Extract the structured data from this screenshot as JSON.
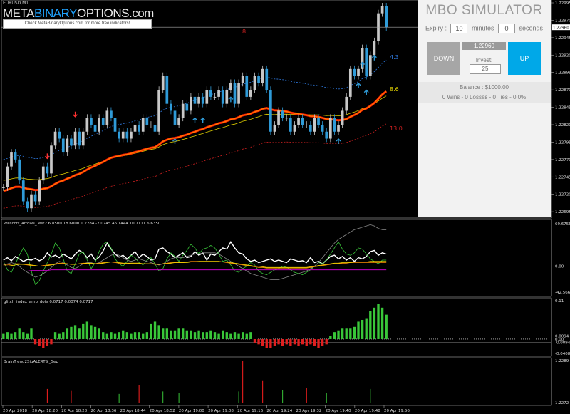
{
  "symbol_label": "EURUSD,M1",
  "watermark": {
    "part1": "META",
    "part2": "BINARY",
    "part3": "OPTIONS.com",
    "link_text": "Check MetaBinaryOptions.com for more free indicators!"
  },
  "mbo": {
    "title": "MBO SIMULATOR",
    "expiry_label": "Expiry :",
    "expiry_minutes": "10",
    "minutes_label": "minutes",
    "expiry_seconds": "0",
    "seconds_label": "seconds",
    "down_label": "DOWN",
    "up_label": "UP",
    "price": "1.22960",
    "invest_label": "Invest:",
    "invest_value": "25",
    "balance": "Balance : $1000.00",
    "stats": "0 Wins - 0 Losses - 0 Ties - 0.0%"
  },
  "colors": {
    "bull": "#c8c8c8",
    "bear": "#2f9bd8",
    "up_arrow": "#2f9bd8",
    "down_arrow": "#ff3030",
    "upper_band": "#2f7ae0",
    "lower_band": "#d02020",
    "ema_yellow": "#e0d000",
    "ema_orange": "#ff8000",
    "ema_red": "#ff2000"
  },
  "chart_data": [
    {
      "type": "candlestick",
      "title": "EURUSD,M1",
      "ylim": [
        1.2269,
        1.22995
      ],
      "yticks": [
        "1.22995",
        "1.22970",
        "1.22945",
        "1.22920",
        "1.22895",
        "1.22870",
        "1.22845",
        "1.22820",
        "1.22795",
        "1.22770",
        "1.22745",
        "1.22720",
        "1.22695"
      ],
      "current_price": "1.22960",
      "line_labels": [
        {
          "text": "4.3",
          "value": 1.22917,
          "color": "#2f7ae0"
        },
        {
          "text": "8.6",
          "value": 1.22871,
          "color": "#e0d000"
        },
        {
          "text": "13.0",
          "value": 1.22815,
          "color": "#d02020"
        },
        {
          "text": "8",
          "value": 1.22954,
          "color": "#d02020"
        }
      ],
      "closes": [
        1.2273,
        1.2276,
        1.2278,
        1.2277,
        1.2274,
        1.2271,
        1.227,
        1.2272,
        1.2271,
        1.2274,
        1.2276,
        1.2275,
        1.2279,
        1.2281,
        1.228,
        1.2278,
        1.228,
        1.2279,
        1.2281,
        1.2279,
        1.2281,
        1.2283,
        1.2282,
        1.2281,
        1.2283,
        1.2282,
        1.2284,
        1.2283,
        1.2281,
        1.228,
        1.2281,
        1.228,
        1.2281,
        1.2282,
        1.2281,
        1.2283,
        1.2282,
        1.2282,
        1.2281,
        1.2287,
        1.2289,
        1.2285,
        1.2284,
        1.2282,
        1.2283,
        1.2285,
        1.2284,
        1.2286,
        1.2285,
        1.2286,
        1.2285,
        1.2287,
        1.2286,
        1.2286,
        1.2287,
        1.2285,
        1.2287,
        1.2288,
        1.2285,
        1.2288,
        1.2289,
        1.2286,
        1.2287,
        1.2289,
        1.2288,
        1.229,
        1.2287,
        1.2281,
        1.2282,
        1.2284,
        1.2283,
        1.2283,
        1.2281,
        1.2282,
        1.2283,
        1.2282,
        1.2282,
        1.2281,
        1.2283,
        1.2282,
        1.2281,
        1.228,
        1.2283,
        1.2281,
        1.2282,
        1.2284,
        1.2286,
        1.229,
        1.2289,
        1.229,
        1.2293,
        1.2289,
        1.2292,
        1.2294,
        1.2298,
        1.2299,
        1.2296
      ],
      "up_arrow_bars": [
        43,
        48,
        50,
        57,
        84,
        89,
        90,
        91,
        93
      ],
      "down_arrow_bars": [
        11,
        18
      ]
    },
    {
      "type": "line",
      "title": "Prescott_Arrows_Test2 6.8500 18.6000 1.2284 -2.0745 46.1444 10.7111 6.6350",
      "ylim": [
        -42.5666,
        69.6756
      ],
      "yticks": [
        "69.6756",
        "0.00",
        "-42.5666"
      ],
      "series": [
        {
          "color": "#ffffff",
          "values": [
            10,
            14,
            9,
            16,
            12,
            8,
            11,
            10,
            13,
            9,
            12,
            22,
            15,
            18,
            14,
            20,
            16,
            12,
            20,
            26,
            22,
            14,
            20,
            10,
            15,
            25,
            38,
            28,
            20,
            15,
            18,
            12,
            18,
            24,
            14,
            20,
            16,
            10,
            12,
            28,
            30,
            24,
            20,
            14,
            18,
            22,
            14,
            16,
            24,
            18,
            22,
            10,
            20,
            18,
            24,
            30,
            28,
            40,
            30,
            22,
            20,
            12,
            8,
            10,
            6,
            8,
            10,
            12,
            8,
            10,
            8,
            6,
            12,
            10,
            8,
            9,
            6,
            14,
            6,
            8,
            4,
            10,
            16,
            18,
            12,
            16,
            10,
            14,
            8,
            14,
            12,
            16,
            24,
            26,
            18,
            22,
            20
          ]
        },
        {
          "color": "#39c639",
          "values": [
            8,
            -6,
            -10,
            4,
            18,
            30,
            20,
            -8,
            -30,
            -24,
            -8,
            6,
            20,
            38,
            30,
            12,
            -8,
            -12,
            4,
            20,
            24,
            10,
            -4,
            6,
            24,
            36,
            40,
            30,
            12,
            4,
            0,
            8,
            18,
            14,
            6,
            2,
            10,
            14,
            4,
            -8,
            -4,
            12,
            22,
            16,
            8,
            18,
            26,
            36,
            30,
            20,
            28,
            30,
            34,
            30,
            20,
            8,
            10,
            2,
            -8,
            -10,
            -4,
            0,
            6,
            2,
            -8,
            -12,
            -14,
            -10,
            -6,
            -4,
            0,
            -2,
            -6,
            -10,
            -12,
            -14,
            -10,
            -6,
            0,
            6,
            4,
            10,
            20,
            30,
            40,
            28,
            20,
            18,
            22,
            30,
            28,
            20,
            12,
            8,
            4,
            10,
            10
          ]
        },
        {
          "color": "#8a8a8a",
          "values": [
            2,
            4,
            6,
            4,
            0,
            -6,
            -10,
            -14,
            -18,
            -16,
            -12,
            -8,
            -2,
            4,
            8,
            6,
            2,
            -2,
            -4,
            0,
            4,
            6,
            6,
            4,
            6,
            10,
            14,
            18,
            20,
            18,
            14,
            10,
            8,
            10,
            12,
            10,
            8,
            6,
            4,
            2,
            4,
            8,
            12,
            14,
            14,
            14,
            16,
            18,
            20,
            20,
            22,
            22,
            22,
            22,
            20,
            16,
            12,
            8,
            4,
            0,
            -4,
            -8,
            -12,
            -14,
            -16,
            -18,
            -20,
            -22,
            -22,
            -22,
            -20,
            -18,
            -16,
            -14,
            -12,
            -10,
            -8,
            -4,
            0,
            6,
            14,
            22,
            30,
            38,
            44,
            48,
            52,
            56,
            60,
            62,
            64,
            66,
            68,
            66,
            62,
            60,
            60
          ]
        },
        {
          "color": "#ff9000",
          "values": [
            2,
            2,
            3,
            4,
            4,
            3,
            2,
            1,
            0,
            0,
            1,
            2,
            3,
            4,
            5,
            5,
            4,
            3,
            3,
            4,
            5,
            5,
            4,
            4,
            5,
            6,
            7,
            7,
            6,
            5,
            4,
            4,
            5,
            5,
            5,
            4,
            4,
            4,
            3,
            3,
            4,
            5,
            6,
            6,
            6,
            6,
            7,
            8,
            8,
            8,
            8,
            8,
            8,
            8,
            8,
            7,
            6,
            5,
            4,
            3,
            2,
            1,
            0,
            -1,
            -2,
            -2,
            -3,
            -3,
            -3,
            -3,
            -3,
            -3,
            -3,
            -3,
            -3,
            -3,
            -3,
            -2,
            -1,
            0,
            1,
            2,
            3,
            4,
            4,
            5,
            5,
            6,
            6,
            6,
            6,
            6,
            6,
            6,
            6,
            6,
            6
          ]
        },
        {
          "color": "#ffe000",
          "values": [
            0,
            0,
            1,
            2,
            3,
            3,
            3,
            2,
            1,
            0,
            0,
            1,
            2,
            3,
            4,
            4,
            4,
            3,
            3,
            4,
            4,
            5,
            5,
            4,
            4,
            5,
            6,
            7,
            7,
            6,
            5,
            5,
            5,
            5,
            5,
            4,
            4,
            4,
            4,
            3,
            4,
            4,
            5,
            6,
            6,
            6,
            6,
            7,
            7,
            8,
            8,
            8,
            8,
            8,
            8,
            7,
            7,
            6,
            5,
            4,
            3,
            2,
            1,
            0,
            0,
            -1,
            -2,
            -2,
            -2,
            -2,
            -2,
            -2,
            -2,
            -2,
            -2,
            -2,
            -2,
            -1,
            0,
            1,
            2,
            3,
            4,
            5,
            5,
            6,
            6,
            6,
            7,
            7,
            7,
            7,
            8,
            8,
            8,
            8,
            8
          ]
        },
        {
          "color": "#e000e0",
          "values": [
            -8,
            -8,
            -8,
            -8,
            -8,
            -8,
            -8,
            -7,
            -7,
            -7,
            -7,
            -7,
            -6,
            -6,
            -6,
            -6,
            -6,
            -6,
            -6,
            -6,
            -6,
            -6,
            -6,
            -6,
            -6,
            -6,
            -6,
            -6,
            -6,
            -6,
            -6,
            -6,
            -6,
            -6,
            -6,
            -6,
            -6,
            -6,
            -6,
            -6,
            -6,
            -6,
            -6,
            -6,
            -6,
            -6,
            -6,
            -6,
            -6,
            -6,
            -6,
            -6,
            -6,
            -6,
            -6,
            -6,
            -6,
            -6,
            -6,
            -6,
            -6,
            -6,
            -6,
            -6,
            -6,
            -6,
            -6,
            -6,
            -6,
            -6,
            -6,
            -6,
            -6,
            -6,
            -6,
            -6,
            -6,
            -6,
            -6,
            -6,
            -6,
            -6,
            -6,
            -6,
            -6,
            -6,
            -6,
            -6,
            -6,
            -6,
            -6,
            -6,
            -6,
            -6,
            -6,
            -6,
            -6
          ]
        }
      ]
    },
    {
      "type": "bar",
      "title": "glitch_index_amp_dots 0.0717 0.0074 0.0717",
      "ylim": [
        -0.0408,
        0.11
      ],
      "yticks": [
        "0.11",
        "0.0094",
        "0.00",
        "-0.0094",
        "-0.0408"
      ],
      "values": [
        0.015,
        0.02,
        0.015,
        0.02,
        0.03,
        0.02,
        0.015,
        0.03,
        -0.015,
        -0.02,
        -0.025,
        -0.02,
        -0.015,
        0.02,
        0.015,
        0.02,
        0.03,
        0.035,
        0.04,
        0.03,
        0.045,
        0.05,
        0.04,
        0.035,
        0.03,
        0.02,
        0.015,
        0.02,
        0.015,
        0.02,
        0.025,
        0.02,
        0.015,
        0.02,
        0.02,
        0.015,
        0.02,
        0.045,
        0.05,
        0.04,
        0.03,
        0.03,
        0.025,
        0.025,
        0.03,
        0.03,
        0.025,
        0.025,
        0.02,
        0.025,
        0.02,
        0.02,
        0.025,
        0.02,
        0.015,
        0.025,
        0.02,
        0.015,
        0.02,
        0.015,
        0.02,
        0.015,
        0.02,
        -0.01,
        -0.015,
        -0.02,
        -0.025,
        -0.025,
        -0.02,
        -0.015,
        -0.02,
        -0.015,
        -0.02,
        -0.015,
        -0.02,
        -0.015,
        -0.02,
        -0.015,
        -0.02,
        -0.025,
        -0.02,
        -0.015,
        0.01,
        0.02,
        0.025,
        0.03,
        0.03,
        0.03,
        0.035,
        0.05,
        0.055,
        0.06,
        0.08,
        0.09,
        0.1,
        0.09,
        0.07
      ]
    },
    {
      "type": "bar",
      "title": "BrainTrend2SigALERTS _Sep",
      "ylim": [
        1.2272,
        1.2289
      ],
      "yticks": [
        "1.2289",
        "1.2272"
      ],
      "bars": [
        {
          "bar": 11,
          "value": 1.22775,
          "color": "#ff2020"
        },
        {
          "bar": 17,
          "value": 1.22767,
          "color": "#ff2020"
        },
        {
          "bar": 29,
          "value": 1.22755,
          "color": "#39c639"
        },
        {
          "bar": 34,
          "value": 1.2279,
          "color": "#ff2020"
        },
        {
          "bar": 40,
          "value": 1.22765,
          "color": "#39c639"
        },
        {
          "bar": 44,
          "value": 1.2276,
          "color": "#39c639"
        },
        {
          "bar": 59,
          "value": 1.22765,
          "color": "#39c639"
        },
        {
          "bar": 60,
          "value": 1.2289,
          "color": "#ff2020"
        },
        {
          "bar": 65,
          "value": 1.2281,
          "color": "#ff2020"
        },
        {
          "bar": 70,
          "value": 1.2277,
          "color": "#39c639"
        },
        {
          "bar": 76,
          "value": 1.2278,
          "color": "#ff2020"
        },
        {
          "bar": 81,
          "value": 1.2276,
          "color": "#39c639"
        },
        {
          "bar": 92,
          "value": 1.22775,
          "color": "#39c639"
        }
      ]
    }
  ],
  "xticks": [
    "20 Apr 2018",
    "20 Apr 18:20",
    "20 Apr 18:28",
    "20 Apr 18:36",
    "20 Apr 18:44",
    "20 Apr 18:52",
    "20 Apr 19:00",
    "20 Apr 19:08",
    "20 Apr 19:16",
    "20 Apr 19:24",
    "20 Apr 19:32",
    "20 Apr 19:40",
    "20 Apr 19:48",
    "20 Apr 19:56"
  ]
}
